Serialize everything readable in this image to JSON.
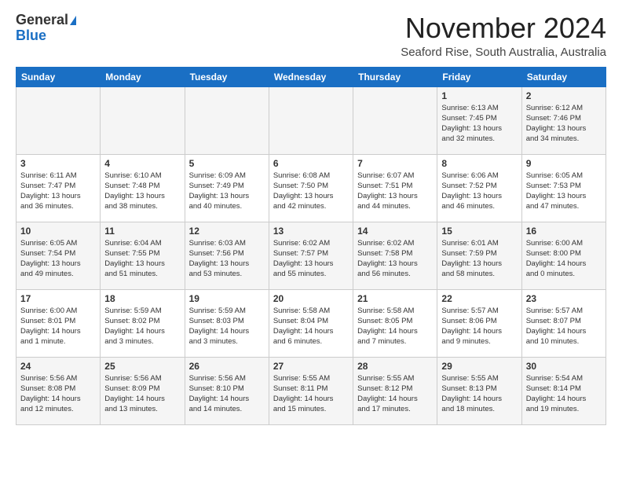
{
  "logo": {
    "general": "General",
    "blue": "Blue"
  },
  "title": "November 2024",
  "subtitle": "Seaford Rise, South Australia, Australia",
  "headers": [
    "Sunday",
    "Monday",
    "Tuesday",
    "Wednesday",
    "Thursday",
    "Friday",
    "Saturday"
  ],
  "weeks": [
    [
      {
        "day": "",
        "info": ""
      },
      {
        "day": "",
        "info": ""
      },
      {
        "day": "",
        "info": ""
      },
      {
        "day": "",
        "info": ""
      },
      {
        "day": "",
        "info": ""
      },
      {
        "day": "1",
        "info": "Sunrise: 6:13 AM\nSunset: 7:45 PM\nDaylight: 13 hours\nand 32 minutes."
      },
      {
        "day": "2",
        "info": "Sunrise: 6:12 AM\nSunset: 7:46 PM\nDaylight: 13 hours\nand 34 minutes."
      }
    ],
    [
      {
        "day": "3",
        "info": "Sunrise: 6:11 AM\nSunset: 7:47 PM\nDaylight: 13 hours\nand 36 minutes."
      },
      {
        "day": "4",
        "info": "Sunrise: 6:10 AM\nSunset: 7:48 PM\nDaylight: 13 hours\nand 38 minutes."
      },
      {
        "day": "5",
        "info": "Sunrise: 6:09 AM\nSunset: 7:49 PM\nDaylight: 13 hours\nand 40 minutes."
      },
      {
        "day": "6",
        "info": "Sunrise: 6:08 AM\nSunset: 7:50 PM\nDaylight: 13 hours\nand 42 minutes."
      },
      {
        "day": "7",
        "info": "Sunrise: 6:07 AM\nSunset: 7:51 PM\nDaylight: 13 hours\nand 44 minutes."
      },
      {
        "day": "8",
        "info": "Sunrise: 6:06 AM\nSunset: 7:52 PM\nDaylight: 13 hours\nand 46 minutes."
      },
      {
        "day": "9",
        "info": "Sunrise: 6:05 AM\nSunset: 7:53 PM\nDaylight: 13 hours\nand 47 minutes."
      }
    ],
    [
      {
        "day": "10",
        "info": "Sunrise: 6:05 AM\nSunset: 7:54 PM\nDaylight: 13 hours\nand 49 minutes."
      },
      {
        "day": "11",
        "info": "Sunrise: 6:04 AM\nSunset: 7:55 PM\nDaylight: 13 hours\nand 51 minutes."
      },
      {
        "day": "12",
        "info": "Sunrise: 6:03 AM\nSunset: 7:56 PM\nDaylight: 13 hours\nand 53 minutes."
      },
      {
        "day": "13",
        "info": "Sunrise: 6:02 AM\nSunset: 7:57 PM\nDaylight: 13 hours\nand 55 minutes."
      },
      {
        "day": "14",
        "info": "Sunrise: 6:02 AM\nSunset: 7:58 PM\nDaylight: 13 hours\nand 56 minutes."
      },
      {
        "day": "15",
        "info": "Sunrise: 6:01 AM\nSunset: 7:59 PM\nDaylight: 13 hours\nand 58 minutes."
      },
      {
        "day": "16",
        "info": "Sunrise: 6:00 AM\nSunset: 8:00 PM\nDaylight: 14 hours\nand 0 minutes."
      }
    ],
    [
      {
        "day": "17",
        "info": "Sunrise: 6:00 AM\nSunset: 8:01 PM\nDaylight: 14 hours\nand 1 minute."
      },
      {
        "day": "18",
        "info": "Sunrise: 5:59 AM\nSunset: 8:02 PM\nDaylight: 14 hours\nand 3 minutes."
      },
      {
        "day": "19",
        "info": "Sunrise: 5:59 AM\nSunset: 8:03 PM\nDaylight: 14 hours\nand 3 minutes."
      },
      {
        "day": "20",
        "info": "Sunrise: 5:58 AM\nSunset: 8:04 PM\nDaylight: 14 hours\nand 6 minutes."
      },
      {
        "day": "21",
        "info": "Sunrise: 5:58 AM\nSunset: 8:05 PM\nDaylight: 14 hours\nand 7 minutes."
      },
      {
        "day": "22",
        "info": "Sunrise: 5:57 AM\nSunset: 8:06 PM\nDaylight: 14 hours\nand 9 minutes."
      },
      {
        "day": "23",
        "info": "Sunrise: 5:57 AM\nSunset: 8:07 PM\nDaylight: 14 hours\nand 10 minutes."
      }
    ],
    [
      {
        "day": "24",
        "info": "Sunrise: 5:56 AM\nSunset: 8:08 PM\nDaylight: 14 hours\nand 12 minutes."
      },
      {
        "day": "25",
        "info": "Sunrise: 5:56 AM\nSunset: 8:09 PM\nDaylight: 14 hours\nand 13 minutes."
      },
      {
        "day": "26",
        "info": "Sunrise: 5:56 AM\nSunset: 8:10 PM\nDaylight: 14 hours\nand 14 minutes."
      },
      {
        "day": "27",
        "info": "Sunrise: 5:55 AM\nSunset: 8:11 PM\nDaylight: 14 hours\nand 15 minutes."
      },
      {
        "day": "28",
        "info": "Sunrise: 5:55 AM\nSunset: 8:12 PM\nDaylight: 14 hours\nand 17 minutes."
      },
      {
        "day": "29",
        "info": "Sunrise: 5:55 AM\nSunset: 8:13 PM\nDaylight: 14 hours\nand 18 minutes."
      },
      {
        "day": "30",
        "info": "Sunrise: 5:54 AM\nSunset: 8:14 PM\nDaylight: 14 hours\nand 19 minutes."
      }
    ]
  ]
}
